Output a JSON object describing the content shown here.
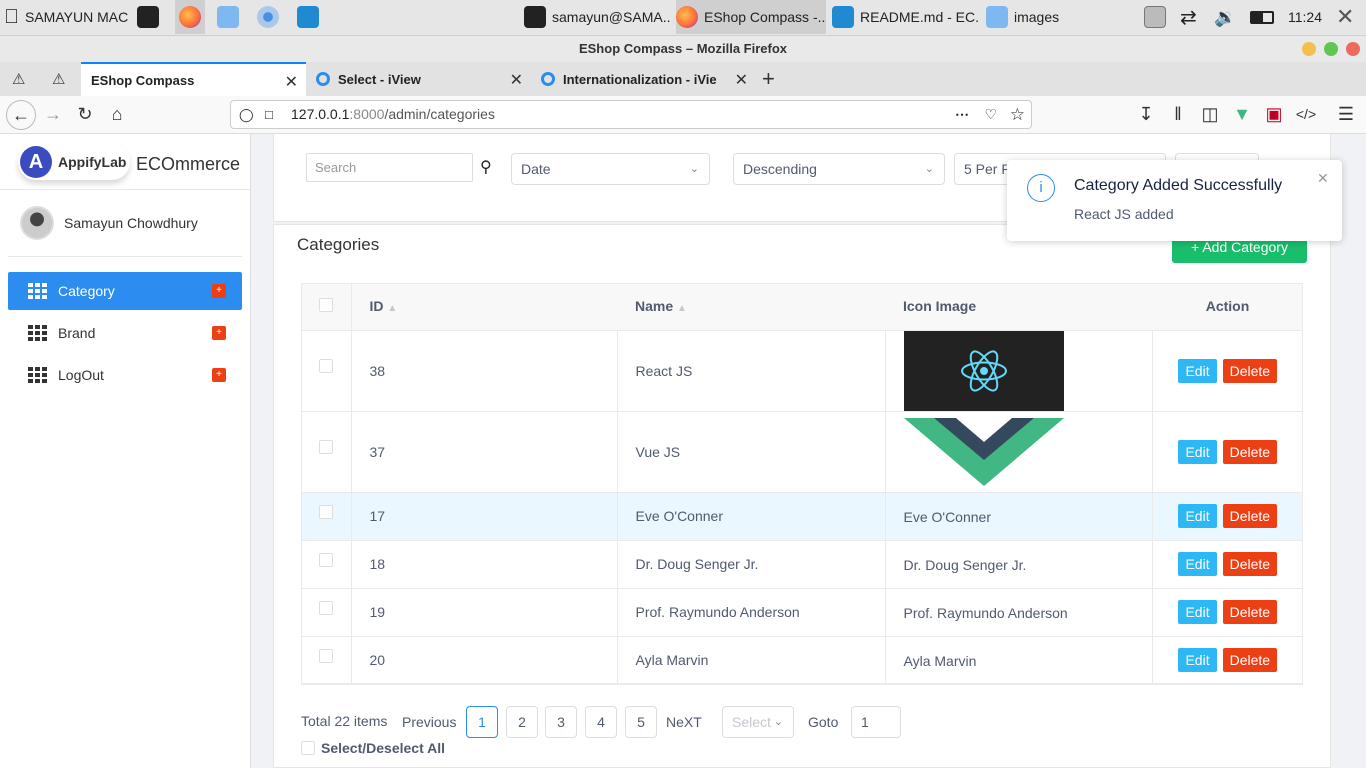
{
  "taskbar": {
    "os_label": "SAMAYUN MAC",
    "windows": [
      "samayun@SAMA...",
      "EShop Compass -...",
      "README.md - EC...",
      "images"
    ],
    "clock": "11:24"
  },
  "browser": {
    "window_title": "EShop Compass – Mozilla Firefox",
    "tabs": [
      {
        "label": "EShop Compass"
      },
      {
        "label": "Select - iView"
      },
      {
        "label": "Internationalization - iVie"
      }
    ],
    "url_host": "127.0.0.1",
    "url_port": ":8000",
    "url_path": "/admin/categories"
  },
  "app": {
    "brand_logo": "AppifyLab",
    "brand_name": "ECOmmerce",
    "user_name": "Samayun Chowdhury",
    "menu": [
      {
        "label": "Category",
        "badge": "+"
      },
      {
        "label": "Brand",
        "badge": "+"
      },
      {
        "label": "LogOut",
        "badge": "+"
      }
    ]
  },
  "filters": {
    "search_placeholder": "Search",
    "sort_by": "Date",
    "order": "Descending",
    "per_page": "5 Per P"
  },
  "notice": {
    "title": "Category Added Successfully",
    "message": "React JS added"
  },
  "categories": {
    "title": "Categories",
    "add_button": "+ Add Category",
    "columns": {
      "id": "ID",
      "name": "Name",
      "icon": "Icon Image",
      "action": "Action"
    },
    "edit_label": "Edit",
    "delete_label": "Delete",
    "rows": [
      {
        "id": "38",
        "name": "React JS",
        "icon": "react-logo"
      },
      {
        "id": "37",
        "name": "Vue JS",
        "icon": "vue-logo"
      },
      {
        "id": "17",
        "name": "Eve O'Conner",
        "icon_text": "Eve O'Conner"
      },
      {
        "id": "18",
        "name": "Dr. Doug Senger Jr.",
        "icon_text": "Dr. Doug Senger Jr."
      },
      {
        "id": "19",
        "name": "Prof. Raymundo Anderson",
        "icon_text": "Prof. Raymundo Anderson"
      },
      {
        "id": "20",
        "name": "Ayla Marvin",
        "icon_text": "Ayla Marvin"
      }
    ]
  },
  "pagination": {
    "total": "Total 22 items",
    "prev": "Previous",
    "pages": [
      "1",
      "2",
      "3",
      "4",
      "5"
    ],
    "current": "1",
    "next": "NeXT",
    "select_placeholder": "Select",
    "goto_label": "Goto",
    "goto_value": "1",
    "select_all": "Select/Deselect All"
  },
  "colors": {
    "primary": "#2d8cf0",
    "success": "#19be6b",
    "info": "#2db7f5",
    "danger": "#ed3f14"
  }
}
